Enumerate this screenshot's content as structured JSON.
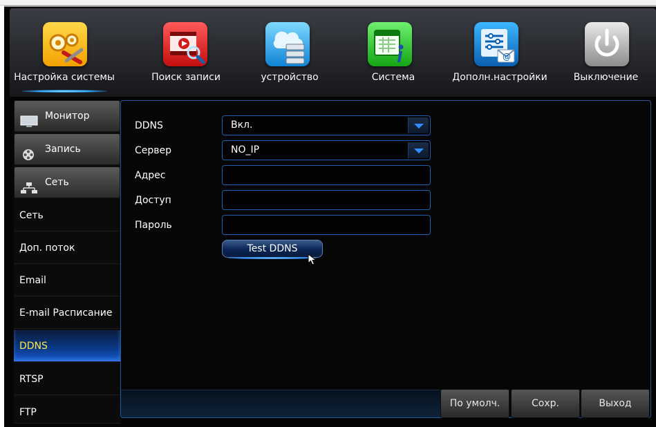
{
  "top_nav": [
    {
      "label": "Настройка системы",
      "icon": "settings-gears-icon",
      "active": true
    },
    {
      "label": "Поиск записи",
      "icon": "record-search-icon"
    },
    {
      "label": "устройство",
      "icon": "device-storage-icon"
    },
    {
      "label": "Система",
      "icon": "system-info-icon"
    },
    {
      "label": "Дополн.настройки",
      "icon": "advanced-settings-icon"
    },
    {
      "label": "Выключение",
      "icon": "power-icon"
    }
  ],
  "sidebar": {
    "groups": [
      {
        "label": "Монитор",
        "icon": "monitor-icon"
      },
      {
        "label": "Запись",
        "icon": "film-reel-icon"
      },
      {
        "label": "Сеть",
        "icon": "network-icon"
      }
    ],
    "items": [
      {
        "label": "Сеть"
      },
      {
        "label": "Доп. поток"
      },
      {
        "label": "Email"
      },
      {
        "label": "E-mail Расписание"
      },
      {
        "label": "DDNS",
        "selected": true
      },
      {
        "label": "RTSP"
      },
      {
        "label": "FTP"
      }
    ]
  },
  "form": {
    "ddns_label": "DDNS",
    "ddns_value": "Вкл.",
    "server_label": "Сервер",
    "server_value": "NO_IP",
    "address_label": "Адрес",
    "address_value": "",
    "access_label": "Доступ",
    "access_value": "",
    "password_label": "Пароль",
    "password_value": "",
    "test_button": "Test DDNS"
  },
  "actions": {
    "default": "По умолч.",
    "save": "Сохр.",
    "exit": "Выход"
  },
  "colors": {
    "accent_blue": "#2f8fff",
    "selected_text": "#ffe84a",
    "field_border": "#1d5fb1"
  }
}
